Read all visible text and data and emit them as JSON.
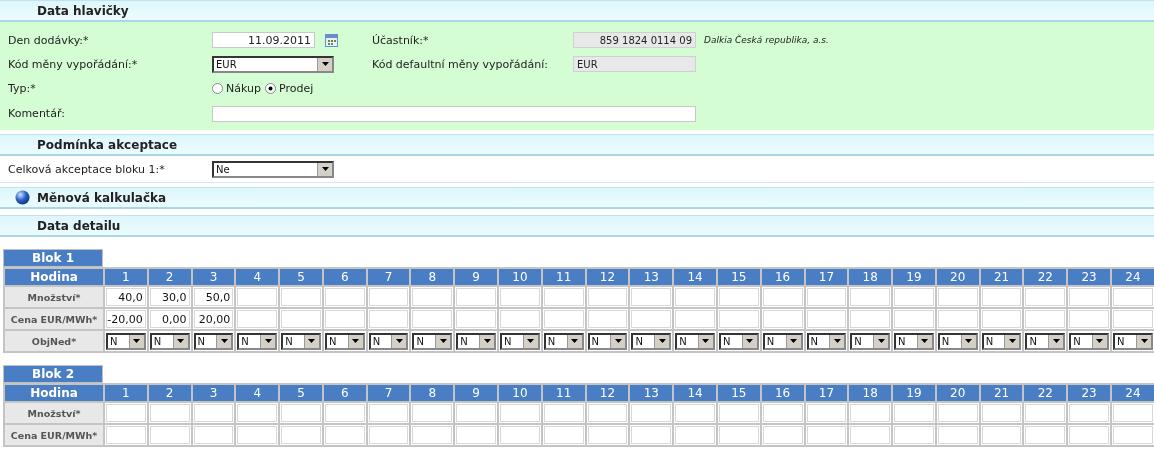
{
  "header_section": {
    "title": "Data hlavičky"
  },
  "header_fields": {
    "delivery_day": {
      "label": "Den dodávky:*",
      "value": "11.09.2011"
    },
    "participant": {
      "label": "Účastník:*",
      "value": "859 1824 0114 09",
      "name": "Dalkia Česká republika, a.s."
    },
    "currency": {
      "label": "Kód měny vypořádání:*",
      "value": "EUR"
    },
    "default_currency": {
      "label": "Kód defaultní měny vypořádání:",
      "value": "EUR"
    },
    "type": {
      "label": "Typ:*",
      "options": [
        {
          "label": "Nákup",
          "selected": false
        },
        {
          "label": "Prodej",
          "selected": true
        }
      ]
    },
    "comment": {
      "label": "Komentář:"
    }
  },
  "acceptance_section": {
    "title": "Podmínka akceptace",
    "label": "Celková akceptace bloku 1:*",
    "value": "Ne"
  },
  "calculator_section": {
    "title": "Měnová kalkulačka"
  },
  "detail_section": {
    "title": "Data detailu"
  },
  "blocks": [
    {
      "title": "Blok 1",
      "hour_label": "Hodina",
      "hours": [
        "1",
        "2",
        "3",
        "4",
        "5",
        "6",
        "7",
        "8",
        "9",
        "10",
        "11",
        "12",
        "13",
        "14",
        "15",
        "16",
        "17",
        "18",
        "19",
        "20",
        "21",
        "22",
        "23",
        "24"
      ],
      "rows": [
        {
          "label": "Množství*",
          "kind": "input",
          "values": [
            "40,0",
            "30,0",
            "50,0"
          ]
        },
        {
          "label": "Cena EUR/MWh*",
          "kind": "input",
          "values": [
            "-20,00",
            "0,00",
            "20,00"
          ]
        },
        {
          "label": "ObjNed*",
          "kind": "select",
          "values": [
            "N",
            "N",
            "N",
            "N",
            "N",
            "N",
            "N",
            "N",
            "N",
            "N",
            "N",
            "N",
            "N",
            "N",
            "N",
            "N",
            "N",
            "N",
            "N",
            "N",
            "N",
            "N",
            "N",
            "N"
          ]
        }
      ]
    },
    {
      "title": "Blok 2",
      "hour_label": "Hodina",
      "hours": [
        "1",
        "2",
        "3",
        "4",
        "5",
        "6",
        "7",
        "8",
        "9",
        "10",
        "11",
        "12",
        "13",
        "14",
        "15",
        "16",
        "17",
        "18",
        "19",
        "20",
        "21",
        "22",
        "23",
        "24"
      ],
      "rows": [
        {
          "label": "Množství*",
          "kind": "input",
          "values": []
        },
        {
          "label": "Cena EUR/MWh*",
          "kind": "input",
          "values": []
        }
      ]
    }
  ]
}
